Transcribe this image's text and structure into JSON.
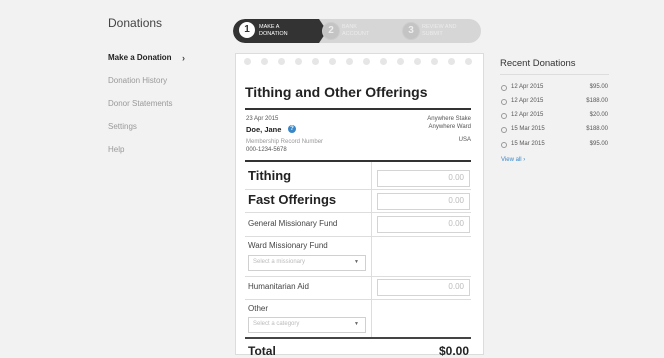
{
  "sidebar": {
    "title": "Donations",
    "items": [
      {
        "label": "Make a Donation",
        "active": true
      },
      {
        "label": "Donation History"
      },
      {
        "label": "Donor Statements"
      },
      {
        "label": "Settings"
      },
      {
        "label": "Help"
      }
    ],
    "active_chevron": "›"
  },
  "steps": [
    {
      "number": "1",
      "label_line1": "MAKE A",
      "label_line2": "DONATION"
    },
    {
      "number": "2",
      "label_line1": "BANK",
      "label_line2": "ACCOUNT"
    },
    {
      "number": "3",
      "label_line1": "REVIEW AND",
      "label_line2": "SUBMIT"
    }
  ],
  "form": {
    "title": "Tithing and Other Offerings",
    "date": "23 Apr 2015",
    "donor_name": "Doe, Jane",
    "help_icon": "?",
    "membership_label": "Membership Record Number",
    "membership_number": "000-1234-5678",
    "stake": "Anywhere Stake",
    "ward": "Anywhere Ward",
    "country": "USA",
    "rows": {
      "tithing": {
        "label": "Tithing",
        "amount": "0.00"
      },
      "fast_offerings": {
        "label": "Fast Offerings",
        "amount": "0.00"
      },
      "general_missionary": {
        "label": "General Missionary Fund",
        "amount": "0.00"
      },
      "ward_missionary": {
        "label": "Ward Missionary Fund",
        "select_placeholder": "Select a missionary"
      },
      "humanitarian": {
        "label": "Humanitarian Aid",
        "amount": "0.00"
      },
      "other": {
        "label": "Other",
        "select_placeholder": "Select a category"
      }
    },
    "total_label": "Total",
    "total_amount": "$0.00"
  },
  "recent": {
    "title": "Recent Donations",
    "items": [
      {
        "date": "12 Apr 2015",
        "amount": "$95.00"
      },
      {
        "date": "12 Apr 2015",
        "amount": "$188.00"
      },
      {
        "date": "12 Apr 2015",
        "amount": "$20.00"
      },
      {
        "date": "15 Mar 2015",
        "amount": "$188.00"
      },
      {
        "date": "15 Mar 2015",
        "amount": "$95.00"
      }
    ],
    "view_all": "View all ›"
  },
  "colors": {
    "accent": "#3a87c8",
    "active_step": "#333333"
  },
  "icons": {
    "dropdown": "chevron-down-icon",
    "help": "question-icon",
    "record": "gift-icon"
  }
}
